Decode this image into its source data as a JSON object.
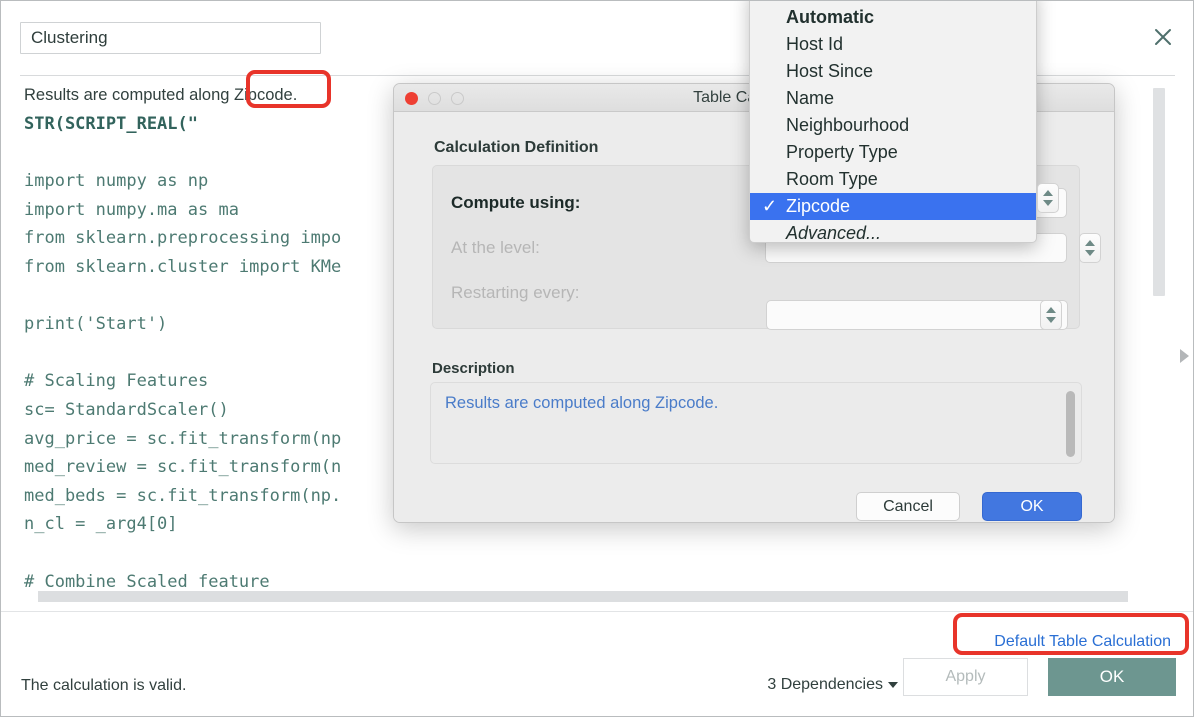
{
  "window": {
    "name_field_value": "Clustering",
    "close_icon": "close-icon"
  },
  "editor": {
    "description_line": "Results are computed along Zipcode.",
    "code_header": "STR(SCRIPT_REAL(\"",
    "code_lines": [
      "",
      "import numpy as np",
      "import numpy.ma as ma",
      "from sklearn.preprocessing impo",
      "from sklearn.cluster import KMe",
      "",
      "print('Start')",
      "",
      "# Scaling Features",
      "sc= StandardScaler()",
      "avg_price = sc.fit_transform(np",
      "med_review = sc.fit_transform(n",
      "med_beds = sc.fit_transform(np.",
      "n_cl = _arg4[0]",
      "",
      "# Combine Scaled feature"
    ]
  },
  "bottom_bar": {
    "validity_message": "The calculation is valid.",
    "default_table_calculation_link": "Default Table Calculation",
    "dependencies_label": "3 Dependencies",
    "apply_label": "Apply",
    "ok_label": "OK"
  },
  "dialog": {
    "title": "Table Calculation",
    "section_label": "Calculation Definition",
    "compute_using_label": "Compute using:",
    "at_the_level_label": "At the level:",
    "restarting_every_label": "Restarting every:",
    "description_label": "Description",
    "description_text": "Results are computed along Zipcode.",
    "cancel_label": "Cancel",
    "ok_label": "OK",
    "traffic_lights": [
      "close-dot",
      "minimize-dot",
      "maximize-dot"
    ]
  },
  "dropdown": {
    "items": [
      {
        "label": "Automatic",
        "bold": true,
        "selected": false,
        "italic": false
      },
      {
        "label": "Host Id",
        "bold": false,
        "selected": false,
        "italic": false
      },
      {
        "label": "Host Since",
        "bold": false,
        "selected": false,
        "italic": false
      },
      {
        "label": "Name",
        "bold": false,
        "selected": false,
        "italic": false
      },
      {
        "label": "Neighbourhood",
        "bold": false,
        "selected": false,
        "italic": false
      },
      {
        "label": "Property Type",
        "bold": false,
        "selected": false,
        "italic": false
      },
      {
        "label": "Room Type",
        "bold": false,
        "selected": false,
        "italic": false
      },
      {
        "label": "Zipcode",
        "bold": false,
        "selected": true,
        "italic": false
      },
      {
        "label": "Advanced...",
        "bold": false,
        "selected": false,
        "italic": true
      }
    ],
    "check_glyph": "✓"
  },
  "colors": {
    "accent_blue": "#3a72ef",
    "dialog_ok_blue": "#4277e0",
    "main_ok_teal": "#6d9690",
    "annotation_red": "#e8342a",
    "link_blue": "#2a6fd4",
    "code_green": "#4d7a72"
  }
}
